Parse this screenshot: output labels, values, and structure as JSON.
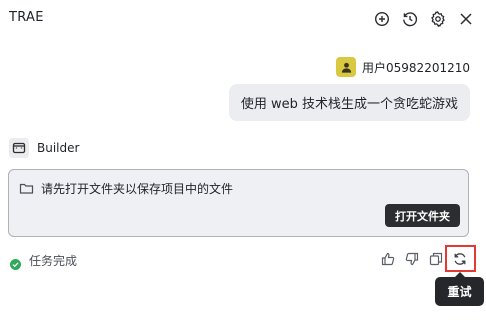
{
  "header": {
    "title": "TRAE",
    "icons": [
      "add-chat-icon",
      "history-icon",
      "settings-icon",
      "close-icon"
    ]
  },
  "user_message": {
    "username": "用户05982201210",
    "text": "使用 web 技术栈生成一个贪吃蛇游戏"
  },
  "agent": {
    "name": "Builder"
  },
  "prompt_card": {
    "text": "请先打开文件夹以保存项目中的文件",
    "button_label": "打开文件夹"
  },
  "status": {
    "text": "任务完成"
  },
  "actions": {
    "icons": [
      "thumbs-up-icon",
      "thumbs-down-icon",
      "copy-icon",
      "retry-icon"
    ]
  },
  "tooltip": {
    "text": "重试"
  },
  "colors": {
    "highlight": "#e53935",
    "success": "#2eaa5a",
    "button_dark": "#2b2d31",
    "avatar": "#d9c941"
  }
}
